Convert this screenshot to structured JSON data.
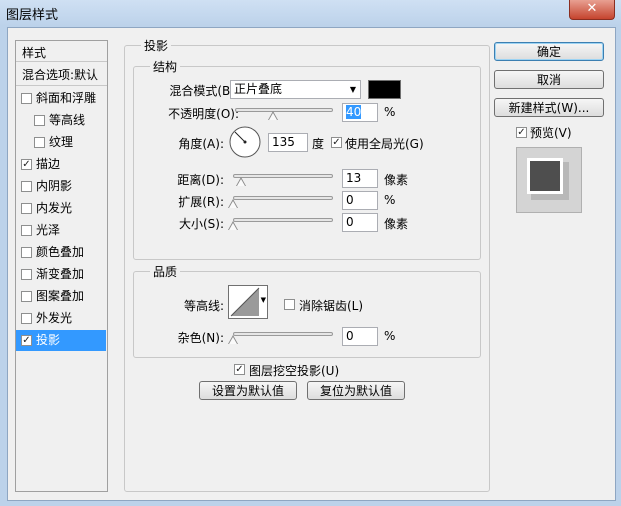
{
  "window": {
    "title": "图层样式",
    "close_glyph": "✕"
  },
  "styles_panel": {
    "header": "样式",
    "blending_options": "混合选项:默认",
    "items": [
      {
        "label": "斜面和浮雕",
        "checked": false
      },
      {
        "label": "等高线",
        "checked": false
      },
      {
        "label": "纹理",
        "checked": false
      },
      {
        "label": "描边",
        "checked": true
      },
      {
        "label": "内阴影",
        "checked": false
      },
      {
        "label": "内发光",
        "checked": false
      },
      {
        "label": "光泽",
        "checked": false
      },
      {
        "label": "颜色叠加",
        "checked": false
      },
      {
        "label": "渐变叠加",
        "checked": false
      },
      {
        "label": "图案叠加",
        "checked": false
      },
      {
        "label": "外发光",
        "checked": false
      },
      {
        "label": "投影",
        "checked": true,
        "selected": true
      }
    ]
  },
  "drop_shadow": {
    "title": "投影",
    "structure": {
      "title": "结构",
      "blend_mode_label": "混合模式(B):",
      "blend_mode_value": "正片叠底",
      "blend_color": "#000000",
      "opacity_label": "不透明度(O):",
      "opacity_value": "40",
      "opacity_unit": "%",
      "angle_label": "角度(A):",
      "angle_value": "135",
      "angle_unit": "度",
      "global_light_label": "使用全局光(G)",
      "global_light_checked": true,
      "distance_label": "距离(D):",
      "distance_value": "13",
      "distance_unit": "像素",
      "spread_label": "扩展(R):",
      "spread_value": "0",
      "spread_unit": "%",
      "size_label": "大小(S):",
      "size_value": "0",
      "size_unit": "像素"
    },
    "quality": {
      "title": "品质",
      "contour_label": "等高线:",
      "antialias_label": "消除锯齿(L)",
      "antialias_checked": false,
      "noise_label": "杂色(N):",
      "noise_value": "0",
      "noise_unit": "%"
    },
    "knockout_label": "图层挖空投影(U)",
    "knockout_checked": true,
    "set_default_label": "设置为默认值",
    "reset_default_label": "复位为默认值"
  },
  "actions": {
    "ok": "确定",
    "cancel": "取消",
    "new_style": "新建样式(W)...",
    "preview_label": "预览(V)",
    "preview_checked": true
  },
  "colors": {
    "selection": "#3399ff",
    "title_bar": "#bcd2ea"
  }
}
